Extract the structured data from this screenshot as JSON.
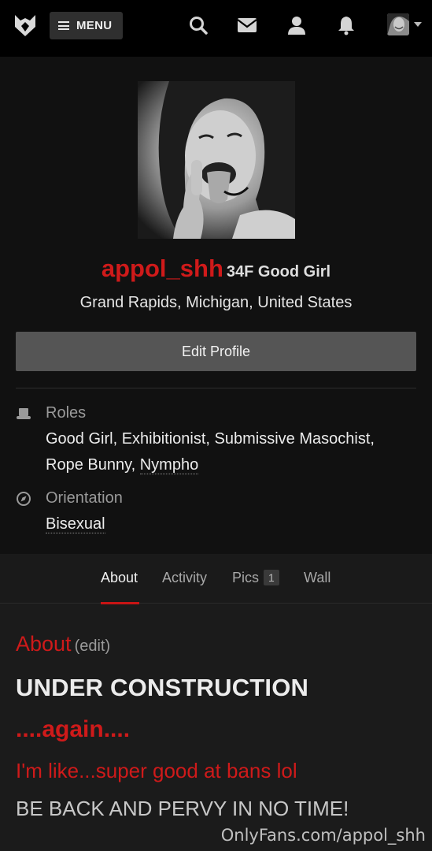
{
  "topbar": {
    "menu_label": "MENU",
    "icons": [
      "fetlife-logo-icon",
      "search-icon",
      "mail-icon",
      "user-icon",
      "bell-icon",
      "avatar",
      "caret-down-icon"
    ]
  },
  "profile": {
    "username": "appol_shh",
    "age_line": "34F Good Girl",
    "location": "Grand Rapids, Michigan, United States",
    "edit_label": "Edit Profile",
    "roles_label": "Roles",
    "roles_line1": "Good Girl, Exhibitionist, Submissive Masochist,",
    "roles_line2_a": "Rope Bunny, ",
    "roles_line2_b": "Nympho",
    "orientation_label": "Orientation",
    "orientation_value": "Bisexual"
  },
  "tabs": {
    "about": "About",
    "activity": "Activity",
    "pics": "Pics",
    "pics_count": "1",
    "wall": "Wall",
    "active": "About"
  },
  "about": {
    "heading": "About",
    "edit": "(edit)",
    "line1": "UNDER CONSTRUCTION",
    "line2": "....again....",
    "line3": "I'm like...super good at bans lol",
    "line4": "BE BACK AND PERVY IN NO TIME!"
  },
  "watermark": "OnlyFans.com/appol_shh",
  "colors": {
    "accent_red": "#cf1a1a",
    "topbar_bg": "#000000",
    "profile_bg": "#111111",
    "content_bg": "#1b1b1b",
    "button_bg": "#555555"
  }
}
